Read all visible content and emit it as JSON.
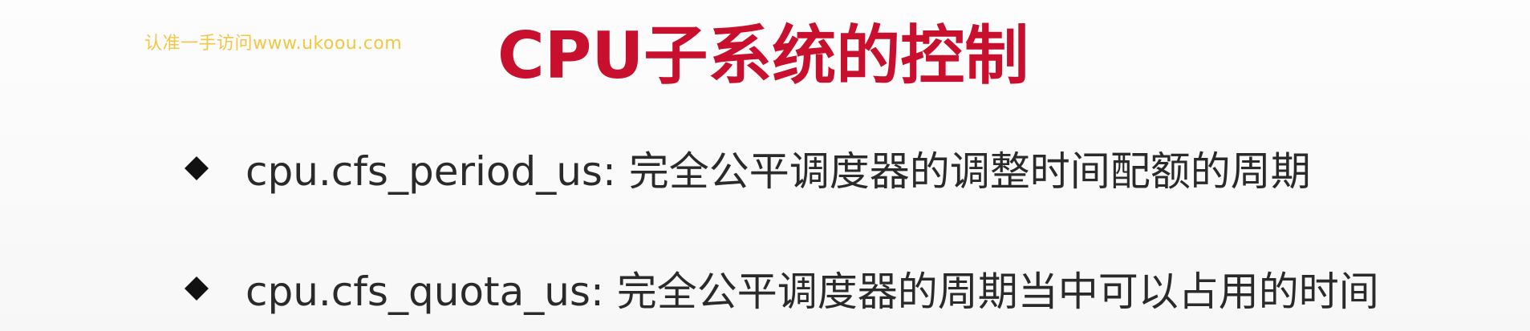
{
  "watermark": "认准一手访问www.ukoou.com",
  "title": "CPU子系统的控制",
  "bullets": [
    {
      "icon": "diamond-bullet-icon",
      "text": "cpu.cfs_period_us: 完全公平调度器的调整时间配额的周期"
    },
    {
      "icon": "diamond-bullet-icon",
      "text": "cpu.cfs_quota_us: 完全公平调度器的周期当中可以占用的时间"
    }
  ],
  "colors": {
    "title": "#c8102e",
    "watermark": "#f2c744",
    "text": "#2a2a2a"
  }
}
